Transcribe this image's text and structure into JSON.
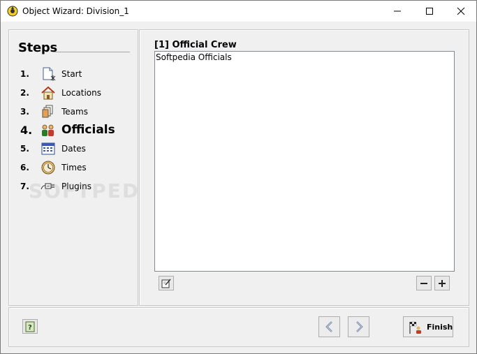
{
  "window": {
    "title": "Object Wizard: Division_1",
    "controls": [
      "minimize-icon",
      "maximize-icon",
      "close-icon"
    ]
  },
  "sidebar": {
    "heading": "Steps",
    "watermark": "SOFTPEDIA",
    "steps": [
      {
        "number": "1.",
        "label": "Start",
        "icon": "new-document-icon",
        "active": false
      },
      {
        "number": "2.",
        "label": "Locations",
        "icon": "house-icon",
        "active": false
      },
      {
        "number": "3.",
        "label": "Teams",
        "icon": "cards-icon",
        "active": false
      },
      {
        "number": "4.",
        "label": "Officials",
        "icon": "people-icon",
        "active": true
      },
      {
        "number": "5.",
        "label": "Dates",
        "icon": "calendar-icon",
        "active": false
      },
      {
        "number": "6.",
        "label": "Times",
        "icon": "clock-icon",
        "active": false
      },
      {
        "number": "7.",
        "label": "Plugins",
        "icon": "plug-icon",
        "active": false
      }
    ]
  },
  "main": {
    "crew_title": "[1] Official Crew",
    "crew_items": [
      "Softpedia Officials"
    ],
    "edit_icon": "edit-icon",
    "remove_label": "−",
    "add_label": "+"
  },
  "footer": {
    "help_icon": "help-icon",
    "back_icon": "chevron-left-icon",
    "next_icon": "chevron-right-icon",
    "finish_label": "Finish"
  },
  "colors": {
    "window_bg": "#f0f0f0",
    "panel_border": "#c9c9c9",
    "list_border": "#828790"
  }
}
